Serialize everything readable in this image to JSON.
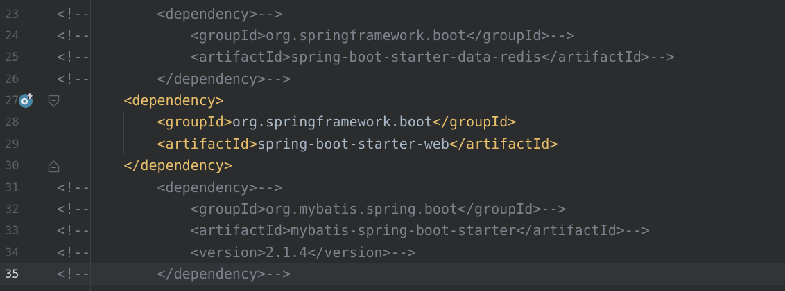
{
  "editor": {
    "type": "code-editor-xml",
    "caret_line": 35,
    "colors": {
      "background": "#2b2c2e",
      "caret_line_background": "#323438",
      "comment": "#7d828c",
      "tag": "#e8bf6a",
      "tag_value": "#a9b7c6",
      "line_number": "#5c6066",
      "active_line_number": "#d5d8dd",
      "gutter_icon_teal": "#4688a8"
    },
    "gutter": {
      "icon": {
        "line": 27,
        "name": "override-navigate-up-icon"
      },
      "fold_markers": [
        {
          "line": 27,
          "type": "fold-region-start",
          "glyph": "-"
        },
        {
          "line": 30,
          "type": "fold-region-end",
          "glyph": "-"
        }
      ]
    },
    "lines": [
      {
        "number": "23",
        "segments": [
          {
            "style": "comment",
            "text": "<!--        <dependency>-->"
          }
        ]
      },
      {
        "number": "24",
        "segments": [
          {
            "style": "comment",
            "text": "<!--            <groupId>org.springframework.boot</groupId>-->"
          }
        ]
      },
      {
        "number": "25",
        "segments": [
          {
            "style": "comment",
            "text": "<!--            <artifactId>spring-boot-starter-data-redis</artifactId>-->"
          }
        ]
      },
      {
        "number": "26",
        "segments": [
          {
            "style": "comment",
            "text": "<!--        </dependency>-->"
          }
        ]
      },
      {
        "number": "27",
        "segments": [
          {
            "style": "text",
            "text": "        "
          },
          {
            "style": "tag",
            "text": "<dependency>"
          }
        ]
      },
      {
        "number": "28",
        "segments": [
          {
            "style": "text",
            "text": "            "
          },
          {
            "style": "tag",
            "text": "<groupId>"
          },
          {
            "style": "text",
            "text": "org.springframework.boot"
          },
          {
            "style": "tag",
            "text": "</groupId>"
          }
        ]
      },
      {
        "number": "29",
        "segments": [
          {
            "style": "text",
            "text": "            "
          },
          {
            "style": "tag",
            "text": "<artifactId>"
          },
          {
            "style": "text",
            "text": "spring-boot-starter-web"
          },
          {
            "style": "tag",
            "text": "</artifactId>"
          }
        ]
      },
      {
        "number": "30",
        "segments": [
          {
            "style": "text",
            "text": "        "
          },
          {
            "style": "tag",
            "text": "</dependency>"
          }
        ]
      },
      {
        "number": "31",
        "segments": [
          {
            "style": "comment",
            "text": "<!--        <dependency>-->"
          }
        ]
      },
      {
        "number": "32",
        "segments": [
          {
            "style": "comment",
            "text": "<!--            <groupId>org.mybatis.spring.boot</groupId>-->"
          }
        ]
      },
      {
        "number": "33",
        "segments": [
          {
            "style": "comment",
            "text": "<!--            <artifactId>mybatis-spring-boot-starter</artifactId>-->"
          }
        ]
      },
      {
        "number": "34",
        "segments": [
          {
            "style": "comment",
            "text": "<!--            <version>2.1.4</version>-->"
          }
        ]
      },
      {
        "number": "35",
        "segments": [
          {
            "style": "comment",
            "text": "<!--        </dependency>-->"
          }
        ]
      }
    ]
  }
}
